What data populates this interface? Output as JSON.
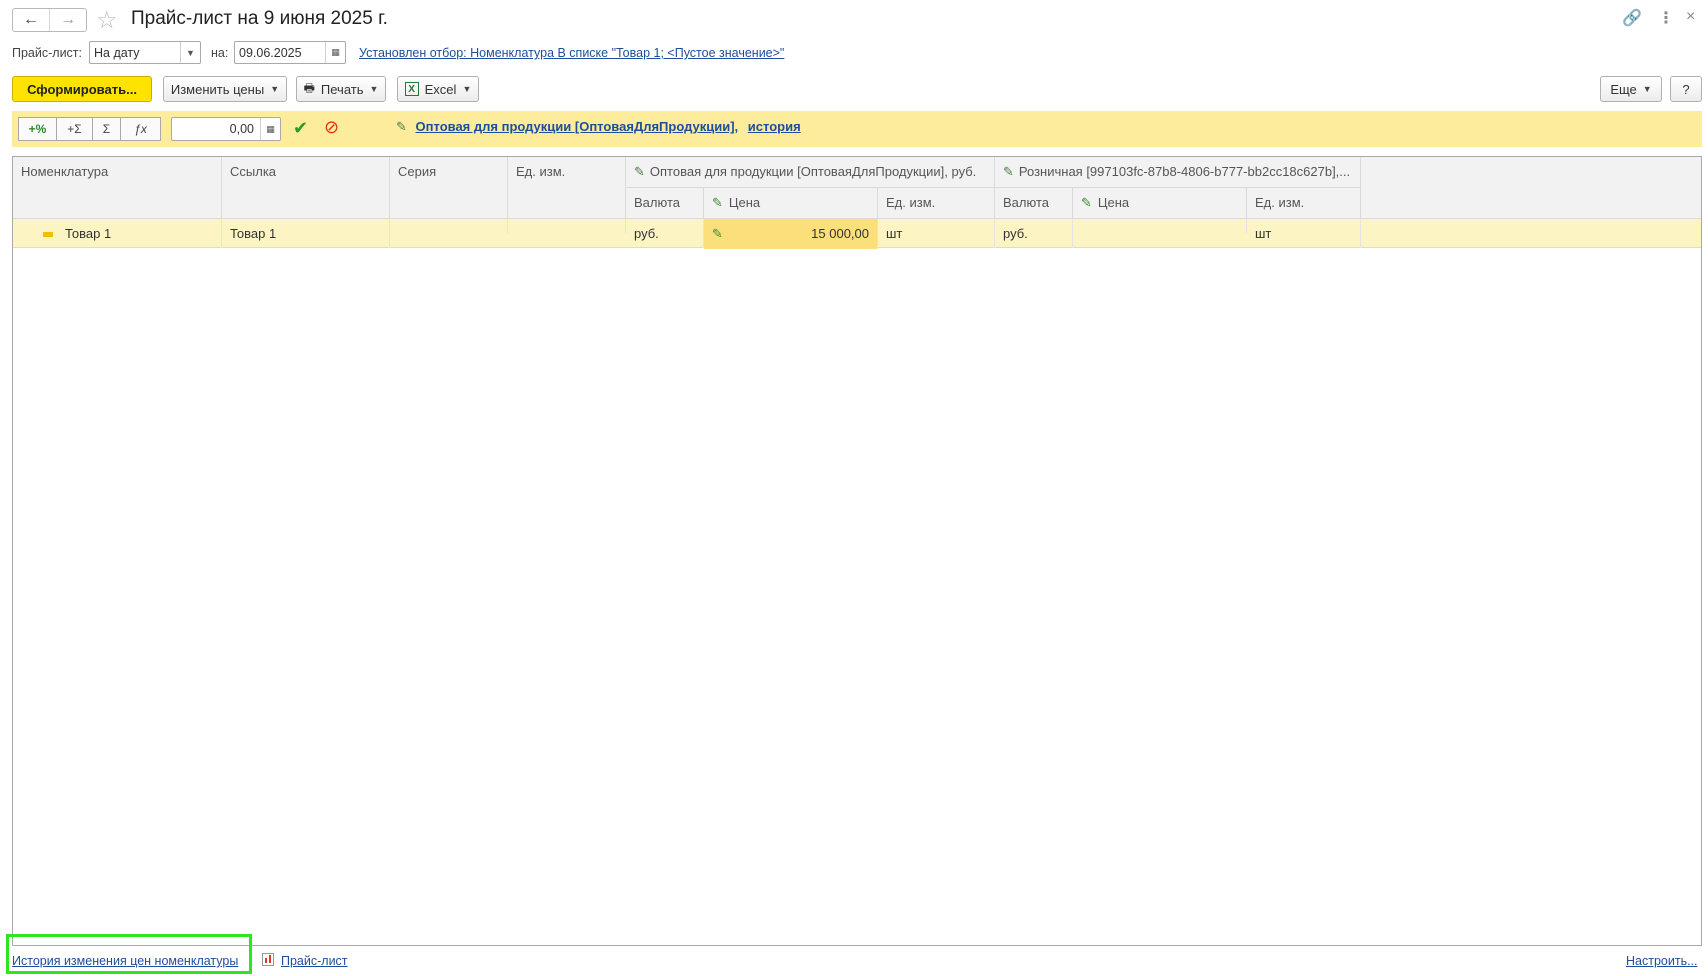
{
  "window": {
    "title": "Прайс-лист на 9 июня 2025 г."
  },
  "filter": {
    "pricelist_label": "Прайс-лист:",
    "pricelist_value": "На дату",
    "date_label": "на:",
    "date_value": "09.06.2025",
    "selection_link": "Установлен отбор: Номенклатура В списке \"Товар 1; <Пустое значение>\""
  },
  "toolbar": {
    "generate_label": "Сформировать...",
    "change_prices_label": "Изменить цены",
    "print_label": "Печать",
    "excel_label": "Excel",
    "more_label": "Еще",
    "help_label": "?"
  },
  "strip": {
    "plus_percent": "+%",
    "plus_sum": "+Σ",
    "sum": "Σ",
    "fx": "ƒx",
    "amount_value": "0,00",
    "price_type_link": "Оптовая для продукции [ОптоваяДляПродукции],",
    "history_link": "история"
  },
  "table": {
    "headers": {
      "nomenclature": "Номенклатура",
      "link": "Ссылка",
      "series": "Серия",
      "unit": "Ед. изм.",
      "group1": "Оптовая для продукции [ОптоваяДляПродукции], руб.",
      "group2": "Розничная [997103fc-87b8-4806-b777-bb2cc18c627b],...",
      "currency": "Валюта",
      "price": "Цена",
      "unit2": "Ед. изм."
    },
    "rows": [
      {
        "nomenclature": "Товар 1",
        "link": "Товар 1",
        "series": "",
        "unit": "",
        "g1_currency": "руб.",
        "g1_price": "15 000,00",
        "g1_unit": "шт",
        "g2_currency": "руб.",
        "g2_price": "",
        "g2_unit": "шт"
      }
    ]
  },
  "footer": {
    "history_link": "История изменения цен номенклатуры",
    "pricelist_link": "Прайс-лист",
    "settings_link": "Настроить..."
  },
  "colors": {
    "accent_yellow": "#ffe300",
    "strip_yellow": "#fcec9c",
    "row_yellow": "#fdf4c4",
    "link_blue": "#1d4e9d",
    "highlight_green": "#2ee620"
  }
}
